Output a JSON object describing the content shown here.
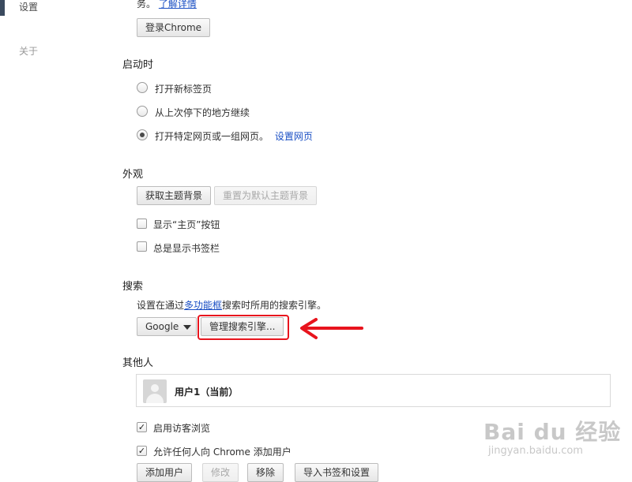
{
  "sidebar": {
    "items": [
      {
        "label": "设置"
      },
      {
        "label": "关于"
      }
    ]
  },
  "signin": {
    "text_end": "务。",
    "learn_more": "了解详情",
    "button": "登录Chrome"
  },
  "startup": {
    "title": "启动时",
    "options": [
      {
        "label": "打开新标签页",
        "checked": false
      },
      {
        "label": "从上次停下的地方继续",
        "checked": false
      },
      {
        "label": "打开特定网页或一组网页。",
        "checked": true
      }
    ],
    "set_pages_link": "设置网页"
  },
  "appearance": {
    "title": "外观",
    "get_themes": "获取主题背景",
    "reset_theme": "重置为默认主题背景",
    "show_home": "显示“主页”按钮",
    "show_bookmarks": "总是显示书签栏"
  },
  "search": {
    "title": "搜索",
    "desc_prefix": "设置在通过",
    "omnibox_link": "多功能框",
    "desc_suffix": "搜索时所用的搜索引擎。",
    "engine": "Google",
    "manage_button": "管理搜索引擎..."
  },
  "people": {
    "title": "其他人",
    "user": "用户1（当前）",
    "guest_label": "启用访客浏览",
    "guest_checked": true,
    "anyone_add_label": "允许任何人向 Chrome 添加用户",
    "anyone_add_checked": true,
    "buttons": {
      "add": "添加用户",
      "edit": "修改",
      "remove": "移除",
      "import": "导入书签和设置"
    }
  },
  "watermark": {
    "main": "Bai du 经验",
    "sub": "jingyan.baidu.com"
  },
  "colors": {
    "link": "#1a4fc4",
    "annotation_red": "#e8141d"
  }
}
